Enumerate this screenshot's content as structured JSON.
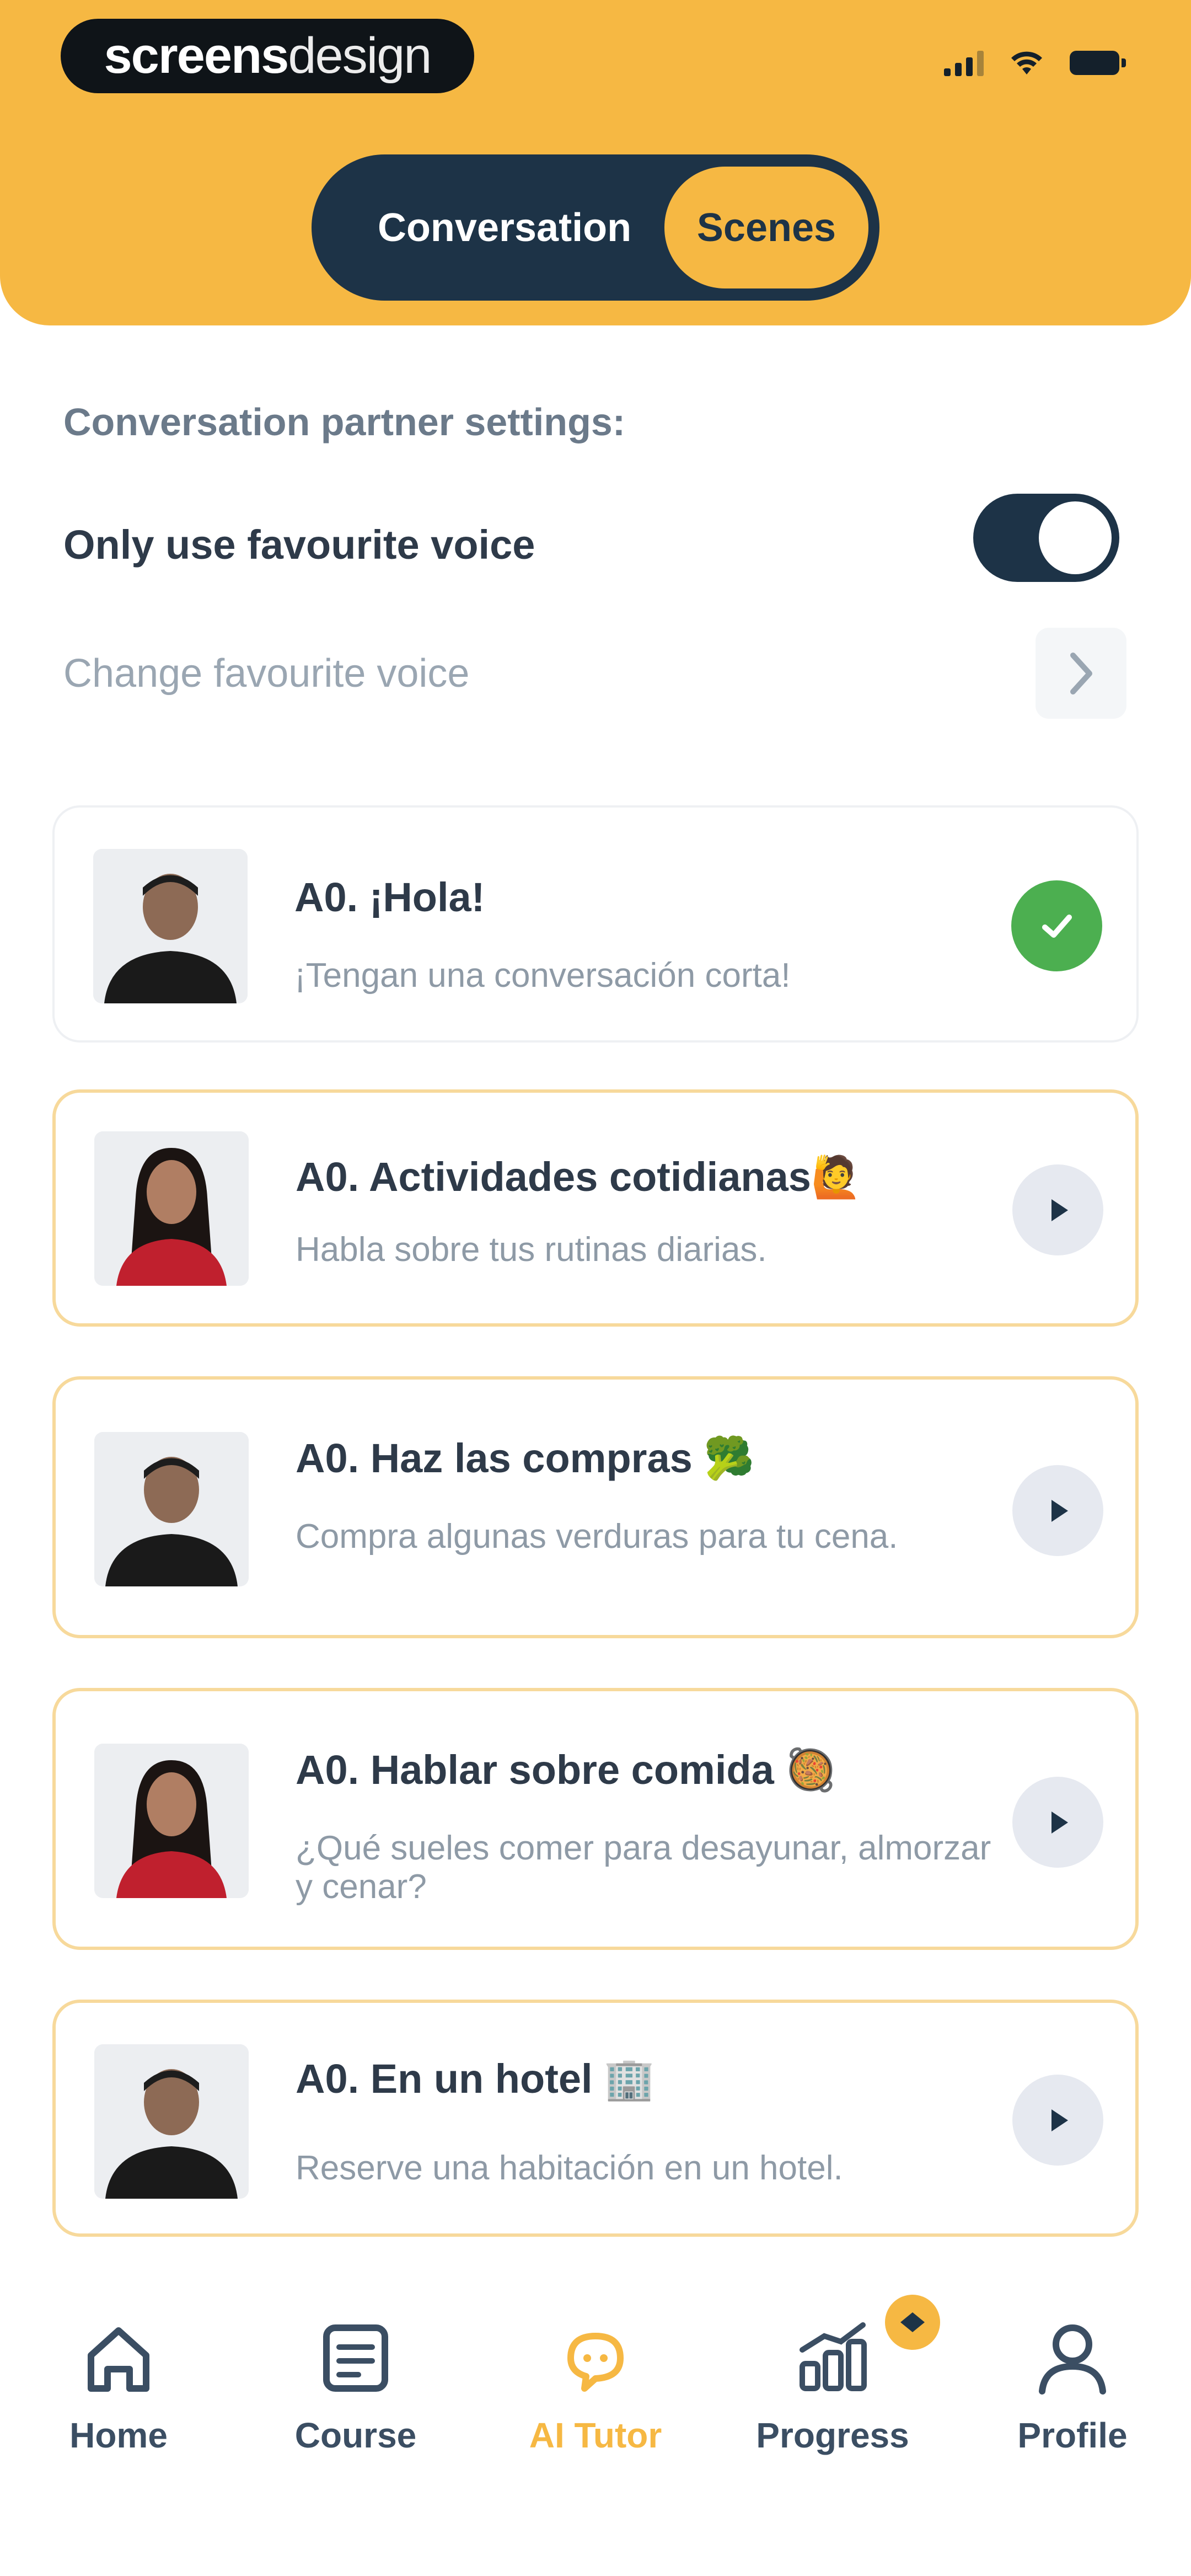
{
  "header": {
    "brand_bold": "screens",
    "brand_light": "design",
    "tabs": [
      {
        "label": "Conversation",
        "active": false
      },
      {
        "label": "Scenes",
        "active": true
      }
    ]
  },
  "settings": {
    "title": "Conversation partner settings:",
    "favourite_toggle_label": "Only use favourite voice",
    "favourite_toggle_on": true,
    "change_voice_label": "Change favourite voice"
  },
  "scenes": [
    {
      "title": "A0. ¡Hola!",
      "subtitle": "¡Tengan una conversación corta!",
      "status": "completed",
      "avatar": "male"
    },
    {
      "title": "A0. Actividades cotidianas🙋",
      "subtitle": "Habla sobre tus rutinas diarias.",
      "status": "play",
      "avatar": "female"
    },
    {
      "title": "A0. Haz las compras 🥦",
      "subtitle": "Compra algunas verduras para tu cena.",
      "status": "play",
      "avatar": "male"
    },
    {
      "title": "A0. Hablar sobre comida 🥘",
      "subtitle": "¿Qué sueles comer para desayunar, almorzar y cenar?",
      "status": "play",
      "avatar": "female"
    },
    {
      "title": "A0. En un hotel 🏢",
      "subtitle": "Reserve una habitación en un hotel.",
      "status": "play",
      "avatar": "male"
    }
  ],
  "nav": {
    "items": [
      {
        "label": "Home",
        "icon": "home-icon"
      },
      {
        "label": "Course",
        "icon": "course-icon"
      },
      {
        "label": "AI Tutor",
        "icon": "ai-tutor-icon",
        "active": true
      },
      {
        "label": "Progress",
        "icon": "progress-icon"
      },
      {
        "label": "Profile",
        "icon": "profile-icon"
      }
    ]
  },
  "colors": {
    "accent": "#f6b843",
    "navy": "#1d3347",
    "success": "#4caf50"
  }
}
